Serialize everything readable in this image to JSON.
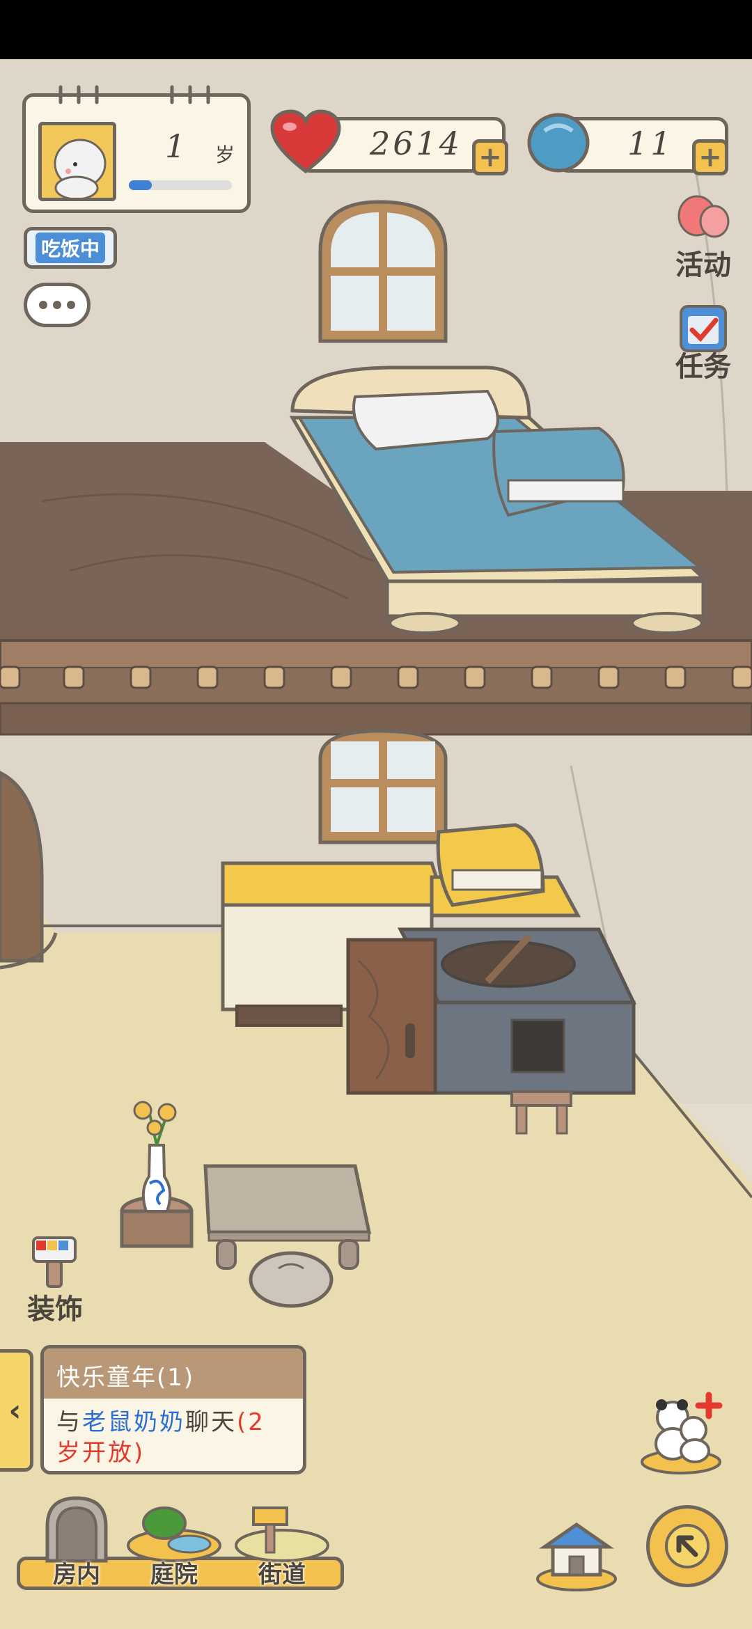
{
  "profile": {
    "age_number": "1",
    "age_unit": "岁",
    "xp_progress": 0.22
  },
  "status": {
    "label": "吃饭中"
  },
  "resources": {
    "hearts": "2614",
    "clovers": "11"
  },
  "side_buttons": {
    "activity_label": "活动",
    "tasks_label": "任务",
    "decorate_label": "装饰"
  },
  "quest": {
    "title": "快乐童年(1)",
    "line1_prefix": "与",
    "line1_name": "老鼠奶奶",
    "line1_action": "聊天",
    "line1_unlock": "(2",
    "line2_unlock": "岁开放)"
  },
  "nav": {
    "items": [
      {
        "label": "房内"
      },
      {
        "label": "庭院"
      },
      {
        "label": "街道"
      }
    ]
  },
  "colors": {
    "outline": "#6e665c",
    "accent_yellow": "#f2c14e",
    "quest_blue": "#2a6fd1",
    "quest_red": "#e23a2e",
    "heart_red": "#d83a3a",
    "clover_blue": "#4e9cc4"
  }
}
